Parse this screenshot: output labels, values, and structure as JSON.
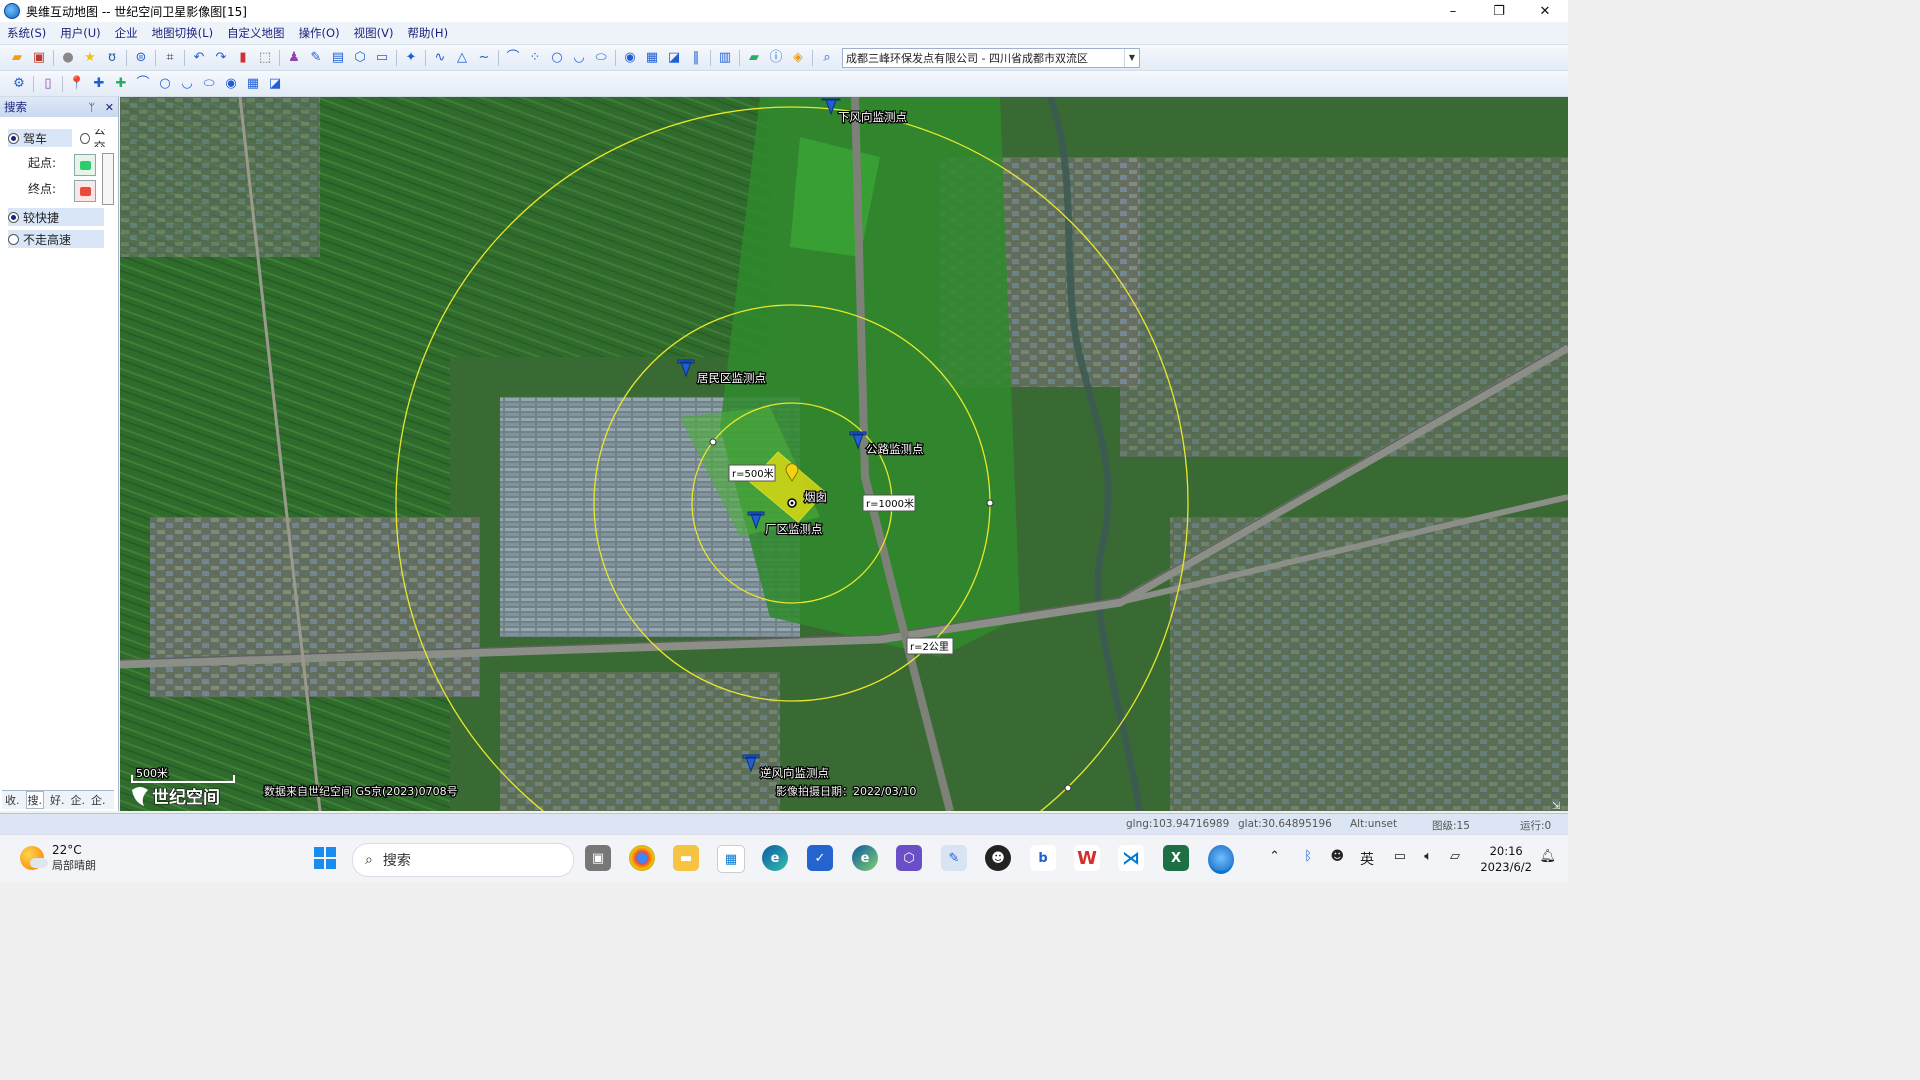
{
  "window": {
    "title": "奥维互动地图 -- 世纪空间卫星影像图[15]",
    "controls": [
      "–",
      "❐",
      "✕"
    ]
  },
  "menubar": [
    "系统(S)",
    "用户(U)",
    "企业",
    "地图切换(L)",
    "自定义地图",
    "操作(O)",
    "视图(V)",
    "帮助(H)"
  ],
  "toolbar": {
    "location_value": "成都三峰环保发点有限公司 - 四川省成都市双流区"
  },
  "sidepanel": {
    "title": "搜索",
    "pin": "ᛘ",
    "close": "✕",
    "mode_drive": "驾车",
    "mode_transit": "公交",
    "start_label": "起点:",
    "end_label": "终点:",
    "option_fast": "较快捷",
    "option_no_highway": "不走高速",
    "tabs": [
      "收.",
      "搜.",
      "好.",
      "企.",
      "企."
    ]
  },
  "map": {
    "markers": {
      "downwind": "下风向监测点",
      "residential": "居民区监测点",
      "road": "公路监测点",
      "chimney": "烟囱",
      "factory": "厂区监测点",
      "upwind": "逆风向监测点"
    },
    "radius_labels": {
      "r500": "r=500米",
      "r1000": "r=1000米",
      "r2000": "r=2公里"
    },
    "scale": "500米",
    "brand": "世纪空间",
    "copyright": "数据来自世纪空间 GS京(2023)0708号",
    "capture_date": "影像拍摄日期：2022/03/10"
  },
  "statusbar": {
    "lng": "glng:103.94716989",
    "lat": "glat:30.64895196",
    "alt": "Alt:unset",
    "level": "图级:15",
    "running": "运行:0"
  },
  "taskbar": {
    "temperature": "22°C",
    "weather": "局部晴朗",
    "search_placeholder": "搜索",
    "ime": "英",
    "time": "20:16",
    "date": "2023/6/2"
  },
  "colors": {
    "ring": "#e8e82a",
    "site_fill": "#d8d814",
    "pin": "#1f5fd6",
    "pin_yellow": "#f2d312"
  }
}
